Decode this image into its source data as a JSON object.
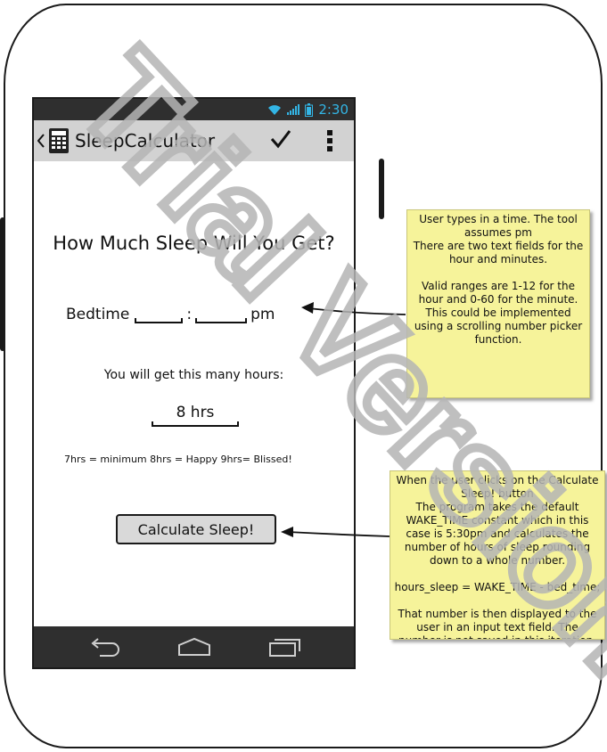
{
  "status_bar": {
    "time": "2:30"
  },
  "action_bar": {
    "title": "SleepCalculator"
  },
  "main": {
    "heading": "How Much Sleep Will You Get?",
    "bedtime_label": "Bedtime",
    "separator": ":",
    "period": "pm",
    "hours_prompt": "You will get this many hours:",
    "hours_value": "8 hrs",
    "legend": "7hrs = minimum 8hrs = Happy 9hrs= Blissed!",
    "calculate_label": "Calculate Sleep!"
  },
  "notes": {
    "input_note": "User types in a time. The tool assumes pm\nThere are two text fields for the hour and minutes.\n\nValid ranges are 1-12 for the hour and 0-60 for the minute. This could be implemented using a scrolling number picker function.",
    "calculate_note": "When the user clicks on the Calculate Sleep! button\nThe program takes the default WAKE_TIME constant which in this case is 5:30pm and calculates the number of hours of sleep rounding down to a whole number.\n\nhours_sleep = WAKE_TIME - bed_time;\n\nThat number is then displayed to the user in an input text field. The number is not saved in this iteration."
  },
  "watermark": {
    "text": "Trial Version"
  },
  "colors": {
    "accent": "#33b5e5",
    "note_bg": "#f6f39a",
    "bar_dark": "#2f2f2f",
    "action_bar": "#d2d2d2"
  }
}
